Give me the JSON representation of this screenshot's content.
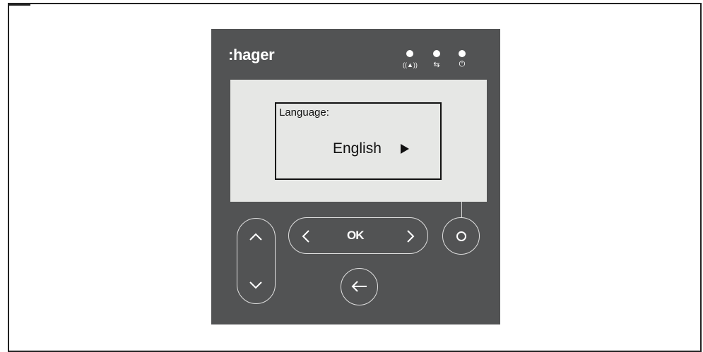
{
  "device": {
    "brand": ":hager",
    "leds": [
      {
        "name": "alarm",
        "icon": "((▲))"
      },
      {
        "name": "communication",
        "icon": "⇆"
      },
      {
        "name": "power",
        "icon": "⏻"
      }
    ],
    "display": {
      "label": "Language:",
      "value": "English"
    },
    "buttons": {
      "ok_label": "OK"
    }
  },
  "colors": {
    "panel": "#525354",
    "screen": "#e6e7e5",
    "outline": "#e0e0e0"
  }
}
